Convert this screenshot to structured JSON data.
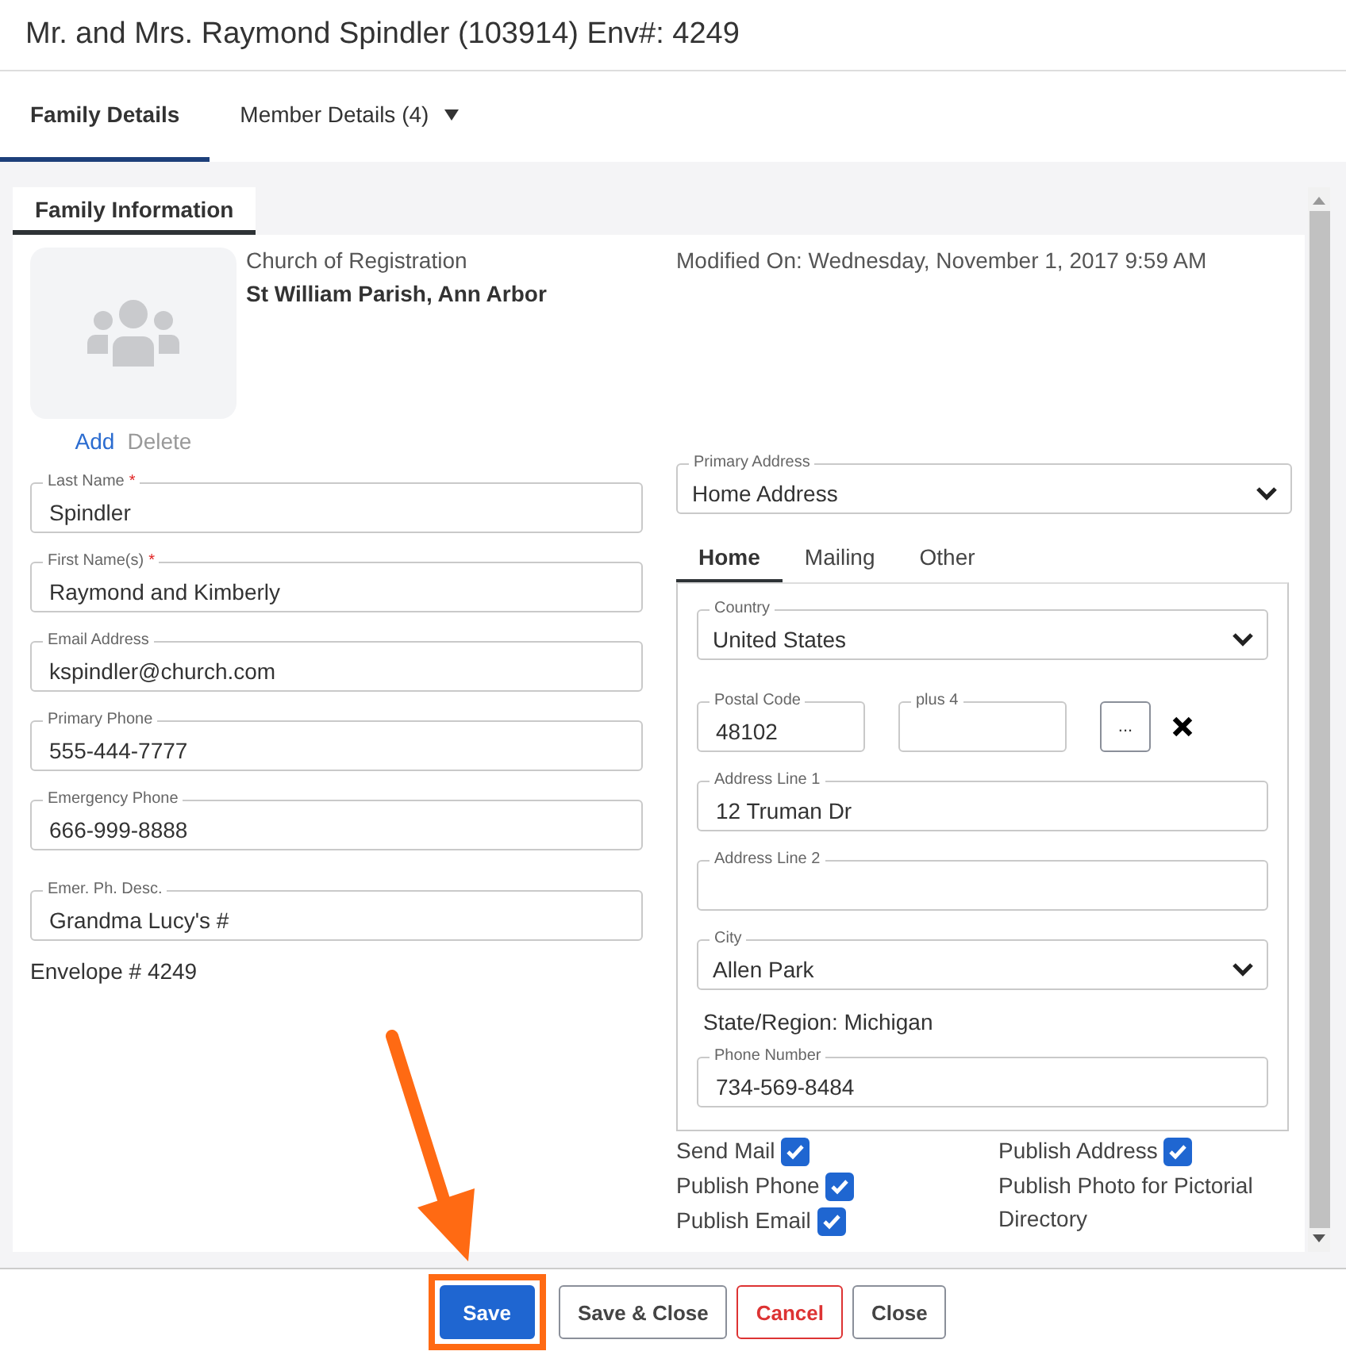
{
  "window": {
    "title": "Mr. and Mrs. Raymond Spindler (103914) Env#: 4249"
  },
  "tabs": [
    {
      "label": "Family Details",
      "selected": true,
      "kind": "tab"
    },
    {
      "label": "Member Details (4)",
      "selected": false,
      "kind": "menu"
    }
  ],
  "section_tab": {
    "label": "Family Information",
    "selected": true
  },
  "photo_actions": [
    {
      "label": "Add",
      "disabled": false
    },
    {
      "label": "Delete",
      "disabled": true
    }
  ],
  "church": {
    "label": "Church of Registration",
    "value": "St William Parish, Ann Arbor"
  },
  "modified": "Modified On: Wednesday, November 1, 2017 9:59 AM",
  "left_fields": [
    {
      "label": "Last Name",
      "required_mark": "*",
      "value": "Spindler"
    },
    {
      "label": "First Name(s)",
      "required_mark": "*",
      "value": "Raymond and Kimberly"
    },
    {
      "label": "Email Address",
      "value": "kspindler@church.com"
    },
    {
      "label": "Primary Phone",
      "value": "555-444-7777"
    },
    {
      "label": "Emergency Phone",
      "value": "666-999-8888"
    },
    {
      "label": "Emer. Ph. Desc.",
      "value": "Grandma Lucy's #"
    }
  ],
  "envelope": "Envelope # 4249",
  "primary_address": {
    "label": "Primary Address",
    "value": "Home Address"
  },
  "address_tabs": [
    {
      "label": "Home",
      "selected": true
    },
    {
      "label": "Mailing",
      "selected": false
    },
    {
      "label": "Other",
      "selected": false
    }
  ],
  "address": {
    "country": {
      "label": "Country",
      "value": "United States"
    },
    "postal_code": {
      "label": "Postal Code",
      "value": "48102"
    },
    "plus4": {
      "label": "plus 4"
    },
    "lookup_button": "...",
    "line1": {
      "label": "Address Line 1",
      "value": "12 Truman Dr"
    },
    "line2": {
      "label": "Address Line 2"
    },
    "city": {
      "label": "City",
      "value": "Allen Park"
    },
    "state": "State/Region: Michigan",
    "phone": {
      "label": "Phone Number",
      "value": "734-569-8484"
    }
  },
  "options_left": [
    {
      "label": "Send Mail",
      "kind": "checkbox",
      "checked": true
    },
    {
      "label": "Publish Phone",
      "kind": "checkbox",
      "checked": true
    },
    {
      "label": "Publish Email",
      "kind": "checkbox",
      "checked": true
    }
  ],
  "options_right": [
    {
      "label": "Publish Address",
      "kind": "checkbox",
      "checked": true
    },
    {
      "label": "Publish Photo for Pictorial Directory",
      "kind": "text"
    }
  ],
  "buttons": [
    {
      "label": "Save",
      "kind": "primary",
      "highlighted": true
    },
    {
      "label": "Save & Close",
      "kind": "default",
      "highlighted": false
    },
    {
      "label": "Cancel",
      "kind": "danger",
      "highlighted": false
    },
    {
      "label": "Close",
      "kind": "default",
      "highlighted": false
    }
  ]
}
